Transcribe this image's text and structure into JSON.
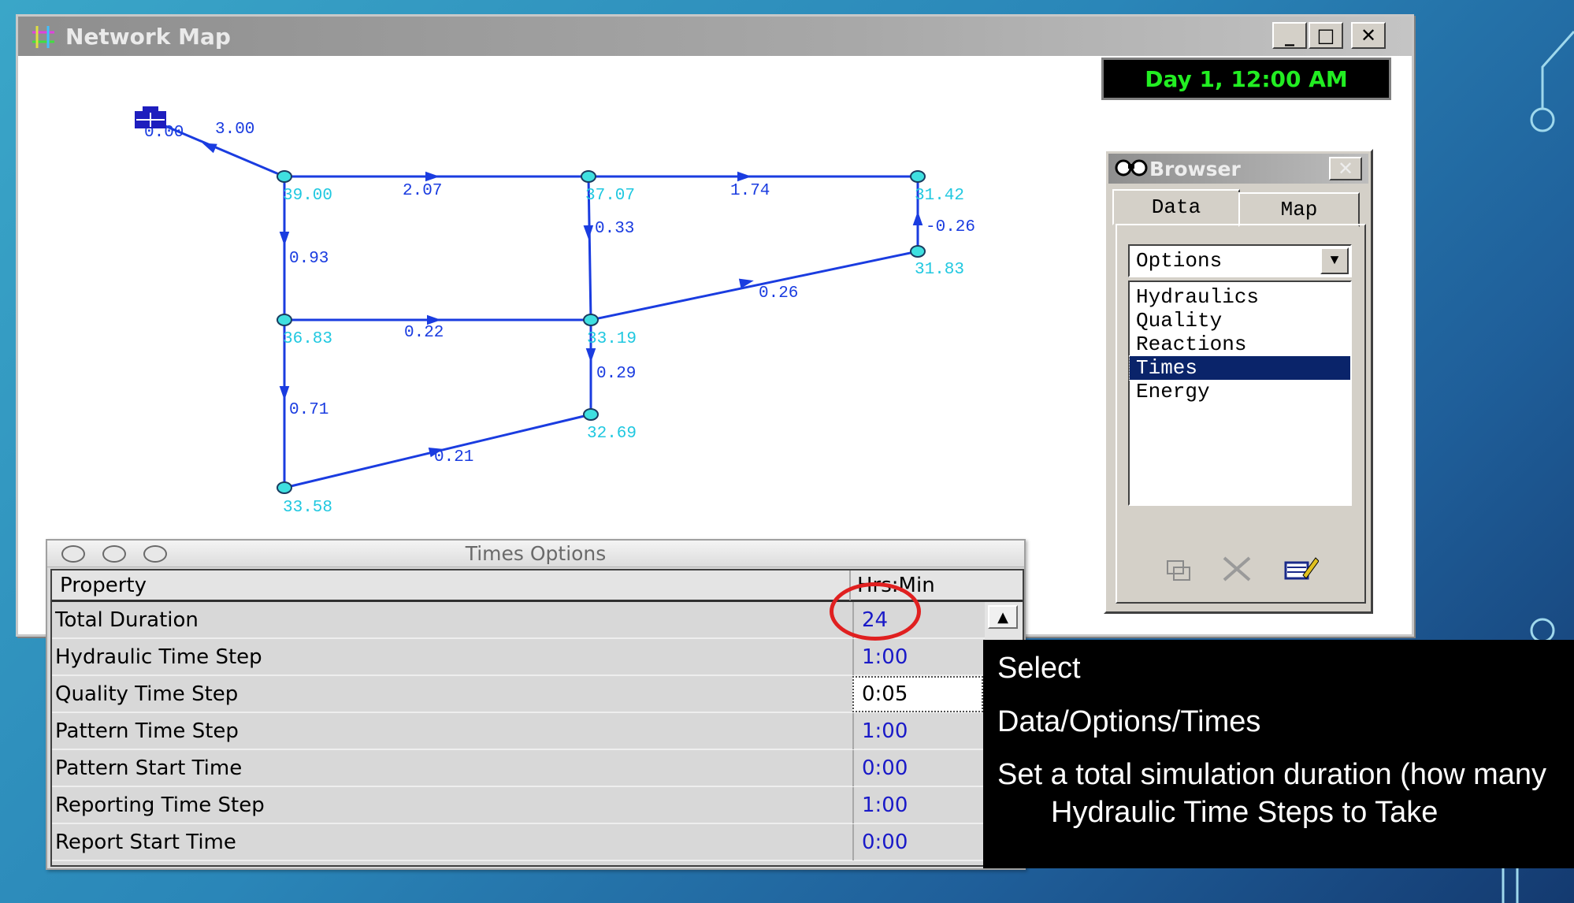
{
  "map_window": {
    "title": "Network Map",
    "buttons": {
      "minimize": "_",
      "maximize": "□",
      "close": "✕"
    },
    "clock": "Day 1, 12:00 AM"
  },
  "network": {
    "node_values": [
      "0.00",
      "39.00",
      "37.07",
      "31.42",
      "31.83",
      "36.83",
      "33.19",
      "32.69",
      "33.58"
    ],
    "link_values": [
      "3.00",
      "2.07",
      "1.74",
      "0.93",
      "0.33",
      "-0.26",
      "0.26",
      "0.22",
      "0.29",
      "0.71",
      "0.21"
    ],
    "colors": {
      "link": "#1a3ce0",
      "node_fill": "#3fe0e0",
      "node_label": "#20c8e0",
      "link_label": "#1a3ce0"
    }
  },
  "browser": {
    "title": "Browser",
    "close": "✕",
    "tabs": [
      "Data",
      "Map"
    ],
    "category_selected": "Options",
    "items": [
      "Hydraulics",
      "Quality",
      "Reactions",
      "Times",
      "Energy"
    ],
    "selected_item": "Times",
    "tool_icons": [
      "add-icon",
      "delete-icon",
      "edit-icon"
    ]
  },
  "times_options": {
    "title": "Times Options",
    "columns": {
      "property": "Property",
      "value": "Hrs:Min"
    },
    "rows": [
      {
        "property": "Total Duration",
        "value": "24"
      },
      {
        "property": "Hydraulic Time Step",
        "value": "1:00"
      },
      {
        "property": "Quality Time Step",
        "value": "0:05"
      },
      {
        "property": "Pattern Time Step",
        "value": "1:00"
      },
      {
        "property": "Pattern Start Time",
        "value": "0:00"
      },
      {
        "property": "Reporting Time Step",
        "value": "1:00"
      },
      {
        "property": "Report Start Time",
        "value": "0:00"
      }
    ],
    "highlight_color": "#e02020"
  },
  "annotation": {
    "line1": "Select",
    "line2": "Data/Options/Times",
    "line3": "Set a total simulation duration (how many",
    "line4": "Hydraulic Time Steps to Take"
  }
}
